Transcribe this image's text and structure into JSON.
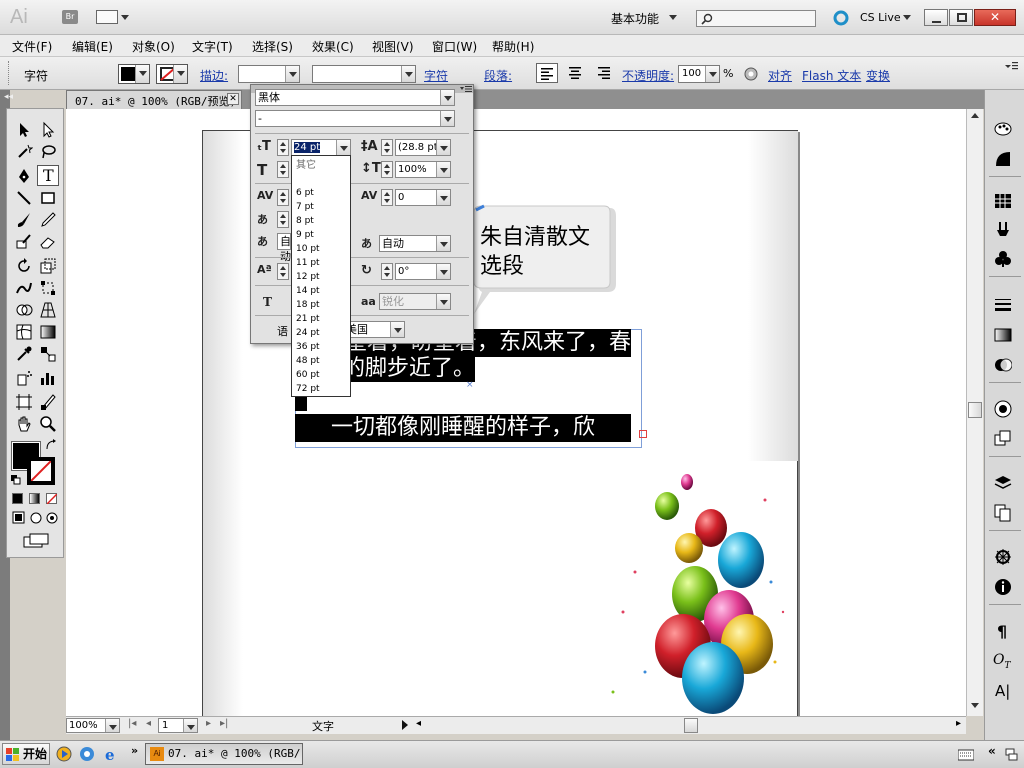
{
  "titlebar": {
    "app_logo": "Ai",
    "bridge_label": "Br",
    "workspace": "基本功能",
    "search_placeholder": "",
    "cslive": "CS Live"
  },
  "menu": [
    "文件(F)",
    "编辑(E)",
    "对象(O)",
    "文字(T)",
    "选择(S)",
    "效果(C)",
    "视图(V)",
    "窗口(W)",
    "帮助(H)"
  ],
  "control": {
    "label_char": "字符",
    "stroke": "描边:",
    "char_link": "字符",
    "para_link": "段落:",
    "opacity_label": "不透明度:",
    "opacity_value": "100",
    "opacity_unit": "%",
    "align": "对齐",
    "flash_text": "Flash 文本",
    "transform": "变换"
  },
  "document_tab": "07. ai* @ 100% (RGB/预览)",
  "char_panel": {
    "font_family": "黑体",
    "font_style": "-",
    "font_size": "24 pt",
    "leading": "(28.8 pt)",
    "vscale": "100%",
    "tracking": "0",
    "auto1": "自动",
    "auto2": "自动",
    "rotation": "0°",
    "anti_alias": "锐化",
    "language_label": "语",
    "language_value": "美国"
  },
  "size_list": {
    "other": "其它",
    "sizes": [
      "6 pt",
      "7 pt",
      "8 pt",
      "9 pt",
      "10 pt",
      "11 pt",
      "12 pt",
      "14 pt",
      "18 pt",
      "21 pt",
      "24 pt",
      "36 pt",
      "48 pt",
      "60 pt",
      "72 pt"
    ]
  },
  "canvas": {
    "callout_line1": "朱自清散文",
    "callout_line2": "选段",
    "text_line1": "盼望着，盼望着，东风来了，春",
    "text_line2": "天的脚步近了。",
    "text_line3": "    一切都像刚睡醒的样子，欣"
  },
  "status": {
    "zoom": "100%",
    "page": "1",
    "tool": "文字"
  },
  "taskbar": {
    "start": "开始",
    "task": "07. ai* @ 100% (RGB/..."
  },
  "colors": {
    "accent": "#1a3aaa",
    "close_button": "#c8342a",
    "callout_bg": "#efefef"
  }
}
